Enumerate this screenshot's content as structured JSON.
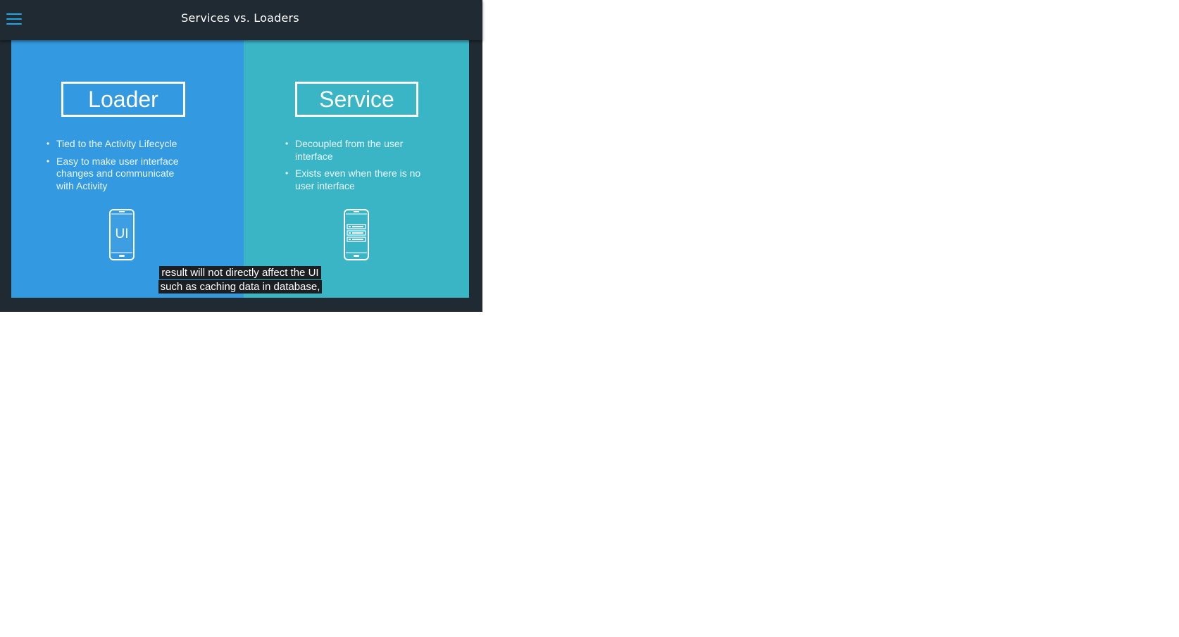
{
  "header": {
    "title": "Services vs. Loaders",
    "menu_icon": "hamburger-menu-icon",
    "accent_color": "#1ea7e8"
  },
  "slide": {
    "left": {
      "heading": "Loader",
      "bullets": [
        "Tied to the Activity Lifecycle",
        "Easy to make user interface changes and communicate with Activity"
      ],
      "icon": "phone-ui-icon",
      "icon_text": "UI",
      "background": "#3399e0"
    },
    "right": {
      "heading": "Service",
      "bullets": [
        "Decoupled from the user interface",
        "Exists even when there is no user interface"
      ],
      "icon": "phone-list-icon",
      "background": "#3ab5c6"
    }
  },
  "captions": {
    "line1": "result will not directly affect the UI",
    "line2": "such as caching data in database,"
  }
}
